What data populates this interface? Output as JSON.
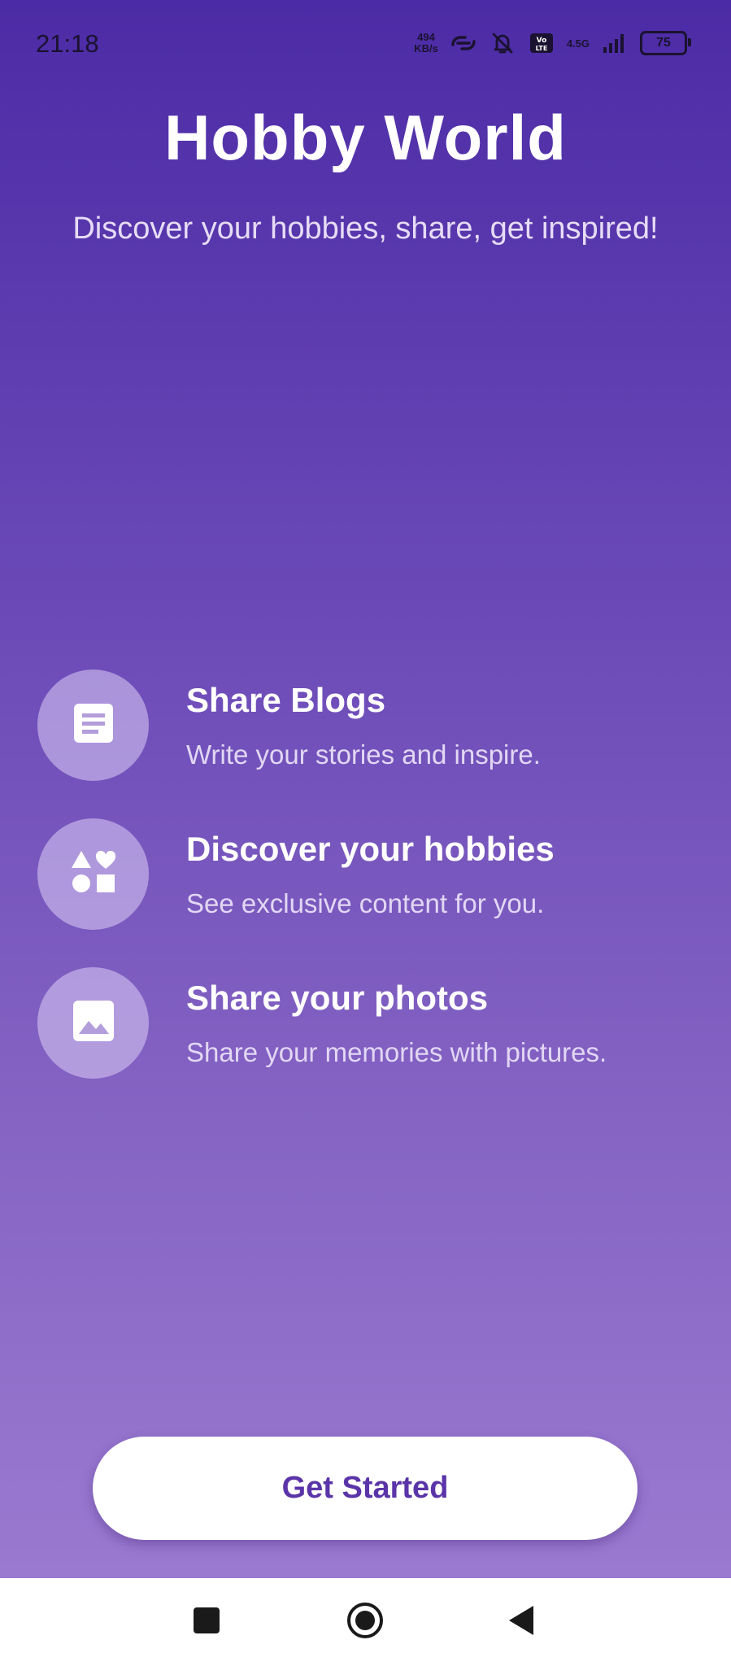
{
  "status_bar": {
    "time": "21:18",
    "net_speed_value": "494",
    "net_speed_unit": "KB/s",
    "network_label": "4.5G",
    "battery_level": "75",
    "icons": [
      "link-icon",
      "bell-muted-icon",
      "volte-icon",
      "signal-icon",
      "battery-icon"
    ]
  },
  "header": {
    "title": "Hobby World",
    "subtitle": "Discover your hobbies, share, get inspired!"
  },
  "features": [
    {
      "icon": "article-icon",
      "title": "Share Blogs",
      "description": "Write your stories and inspire."
    },
    {
      "icon": "shapes-icon",
      "title": "Discover your hobbies",
      "description": "See exclusive content for you."
    },
    {
      "icon": "image-icon",
      "title": "Share your photos",
      "description": "Share your memories with pictures."
    }
  ],
  "cta": {
    "label": "Get Started"
  },
  "nav_bar": {
    "buttons": [
      "recents-button",
      "home-button",
      "back-button"
    ]
  },
  "colors": {
    "gradient_top": "#4c2ba6",
    "gradient_bottom": "#9a7ad0",
    "button_text": "#5a34a8",
    "button_bg": "#ffffff"
  }
}
